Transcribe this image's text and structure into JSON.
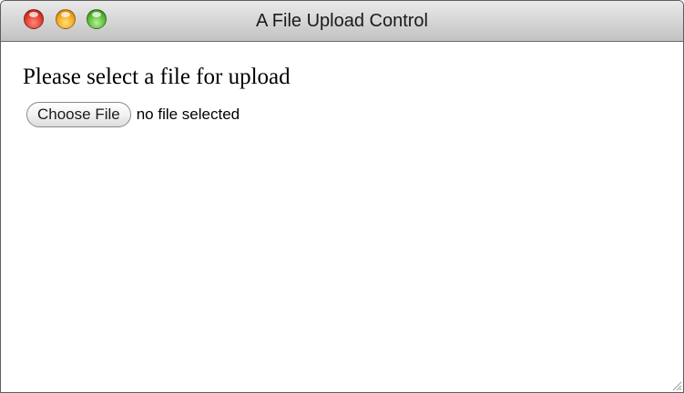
{
  "window": {
    "title": "A File Upload Control",
    "traffic_lights": [
      {
        "name": "close",
        "color": "#e0392c"
      },
      {
        "name": "minimize",
        "color": "#f2a61a"
      },
      {
        "name": "zoom",
        "color": "#59b834"
      }
    ]
  },
  "form": {
    "prompt": "Please select a file for upload",
    "file_input": {
      "button_label": "Choose File",
      "status": "no file selected"
    }
  },
  "icons": {
    "resize": "resize-grip-icon"
  }
}
